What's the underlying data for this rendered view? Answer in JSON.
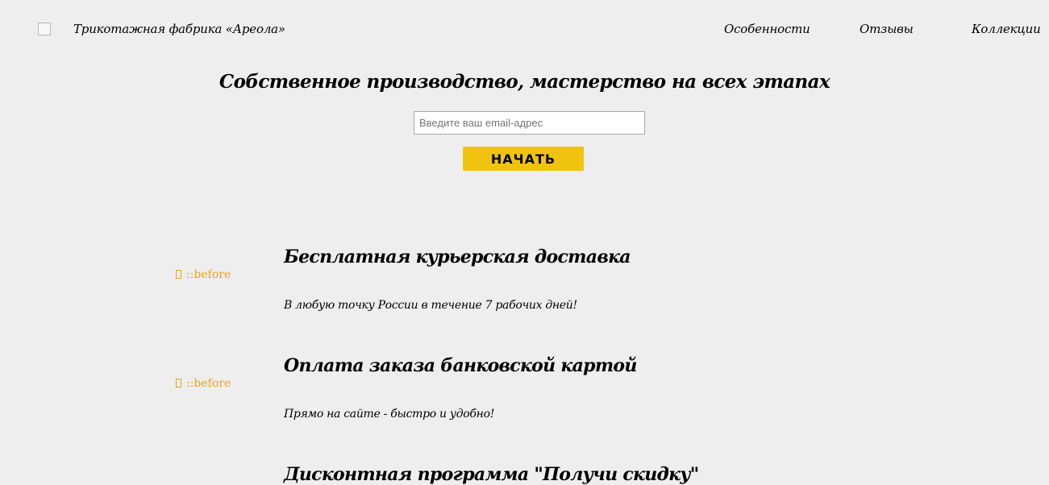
{
  "header": {
    "logo_alt": "",
    "brand": "Трикотажная фабрика «Ареола»",
    "nav": [
      {
        "label": "Особенности"
      },
      {
        "label": "Отзывы"
      },
      {
        "label": "Коллекции"
      }
    ]
  },
  "hero": {
    "title": "Собственное производство, мастерство на всех этапах",
    "email_placeholder": "Введите ваш email-адрес",
    "email_value": "",
    "start_label": "НАЧАТЬ"
  },
  "features": [
    {
      "icon_text": "::before",
      "title": "Бесплатная курьерская доставка",
      "desc": "В любую точку России в течение 7 рабочих дней!"
    },
    {
      "icon_text": "::before",
      "title": "Оплата заказа банковской картой",
      "desc": "Прямо на сайте - быстро и удобно!"
    },
    {
      "title": "Дисконтная программа \"Получи скидку\""
    }
  ],
  "colors": {
    "background": "#eeeeee",
    "accent_button": "#f0c30f",
    "icon": "#e8a317"
  }
}
